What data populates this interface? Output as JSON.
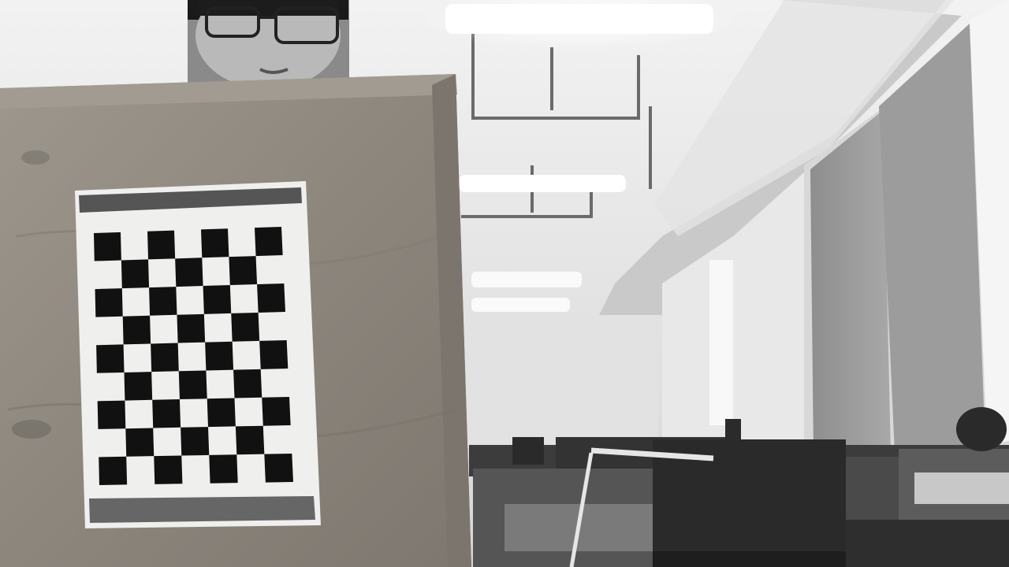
{
  "image": {
    "type": "grayscale-camera-photo",
    "scene": "office-interior",
    "checkerboard": {
      "rows": 9,
      "cols": 7
    },
    "colors": {
      "wood": "#8f8a82",
      "paper": "#f0f0ee",
      "square": "#111111",
      "ceiling": "#e6e6e6",
      "blind": "#9a9a9a"
    }
  }
}
